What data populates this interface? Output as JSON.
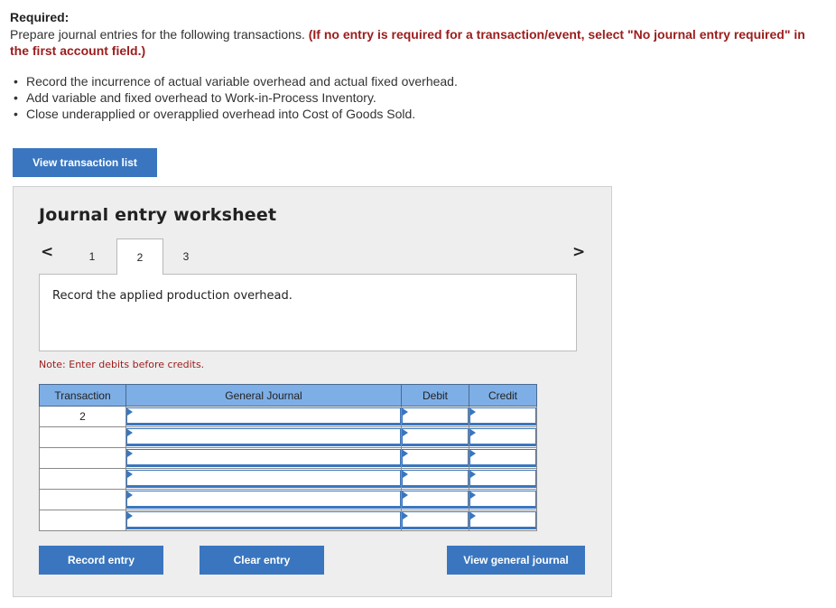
{
  "required": {
    "heading": "Required:",
    "intro": "Prepare journal entries for the following transactions.",
    "emphasis": "(If no entry is required for a transaction/event, select \"No journal entry required\" in the first account field.)"
  },
  "bullets": [
    "Record the incurrence of actual variable overhead and actual fixed overhead.",
    "Add variable and fixed overhead to Work-in-Process Inventory.",
    "Close underapplied or overapplied overhead into Cost of Goods Sold."
  ],
  "buttons": {
    "view_transaction_list": "View transaction list",
    "record_entry": "Record entry",
    "clear_entry": "Clear entry",
    "view_general_journal": "View general journal"
  },
  "worksheet": {
    "title": "Journal entry worksheet",
    "nav_prev": "<",
    "nav_next": ">",
    "tabs": [
      "1",
      "2",
      "3"
    ],
    "active_tab": "2",
    "description": "Record the applied production overhead.",
    "note": "Note: Enter debits before credits."
  },
  "table": {
    "headers": [
      "Transaction",
      "General Journal",
      "Debit",
      "Credit"
    ],
    "rows": [
      {
        "transaction": "2",
        "account": "",
        "debit": "",
        "credit": ""
      },
      {
        "transaction": "",
        "account": "",
        "debit": "",
        "credit": ""
      },
      {
        "transaction": "",
        "account": "",
        "debit": "",
        "credit": ""
      },
      {
        "transaction": "",
        "account": "",
        "debit": "",
        "credit": ""
      },
      {
        "transaction": "",
        "account": "",
        "debit": "",
        "credit": ""
      },
      {
        "transaction": "",
        "account": "",
        "debit": "",
        "credit": ""
      }
    ]
  },
  "colors": {
    "accent": "#3a76bf",
    "header_blue": "#7eaee6",
    "emphasis_red": "#9b1c1c"
  }
}
